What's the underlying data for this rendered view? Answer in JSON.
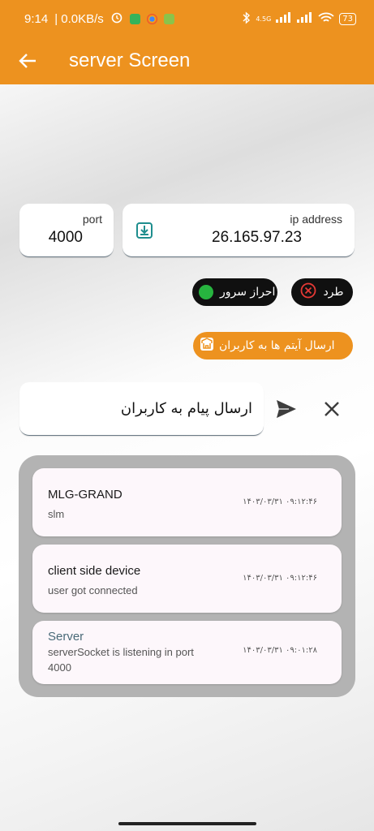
{
  "status_bar": {
    "time": "9:14",
    "net_speed": "| 0.0KB/s",
    "network_type": "4.5G",
    "battery": "73"
  },
  "app_bar": {
    "title": "server Screen",
    "back_icon": "arrow-left-icon"
  },
  "connection": {
    "port_label": "port",
    "port_value": "4000",
    "ip_label": "ip address",
    "ip_value": "26.165.97.23"
  },
  "actions": {
    "reject_label": "طرد",
    "auth_label": "احراز سرور",
    "send_items_label": "ارسال آیتم ها به کاربران"
  },
  "message": {
    "input_value": "ارسال پیام به کاربران"
  },
  "logs": [
    {
      "title": "MLG-GRAND",
      "subtitle": "slm",
      "time": "۱۴۰۳/۰۳/۳۱ ۰۹:۱۲:۴۶"
    },
    {
      "title": "client side device",
      "subtitle": "user got connected",
      "time": "۱۴۰۳/۰۳/۳۱ ۰۹:۱۲:۴۶"
    },
    {
      "title": "Server",
      "subtitle": "serverSocket is listening in port 4000",
      "time": "۱۴۰۳/۰۳/۳۱ ۰۹:۰۱:۲۸"
    }
  ],
  "colors": {
    "accent": "#ED921F",
    "dark_button": "#101010",
    "status_green": "#27b43f",
    "reject_red": "#e53935"
  }
}
